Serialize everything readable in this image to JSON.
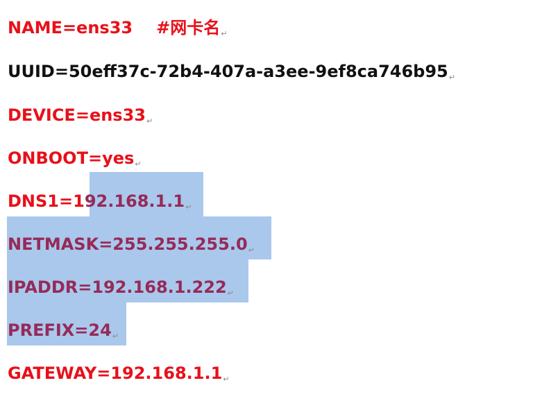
{
  "colors": {
    "red": "#e8101a",
    "black": "#111111",
    "selected": "#962a58",
    "selection_bg": "#a9c8ec"
  },
  "paragraph_mark": "↵",
  "lines": [
    {
      "text": "NAME=ens33",
      "comment": "#网卡名",
      "color": "red"
    },
    {
      "text": "UUID=50eff37c-72b4-407a-a3ee-9ef8ca746b95",
      "color": "black"
    },
    {
      "text": "DEVICE=ens33",
      "color": "red"
    },
    {
      "text": "ONBOOT=yes",
      "color": "red"
    },
    {
      "text_pre": "DNS1=1",
      "text_sel": "92.168.1.1",
      "color": "red",
      "selected_color": "selected"
    },
    {
      "text": "NETMASK=255.255.255.0",
      "color": "selected"
    },
    {
      "text": "IPADDR=192.168.1.222",
      "color": "selected"
    },
    {
      "text": "PREFIX=24",
      "color": "selected"
    },
    {
      "text": "GATEWAY=192.168.1.1",
      "color": "red"
    }
  ]
}
